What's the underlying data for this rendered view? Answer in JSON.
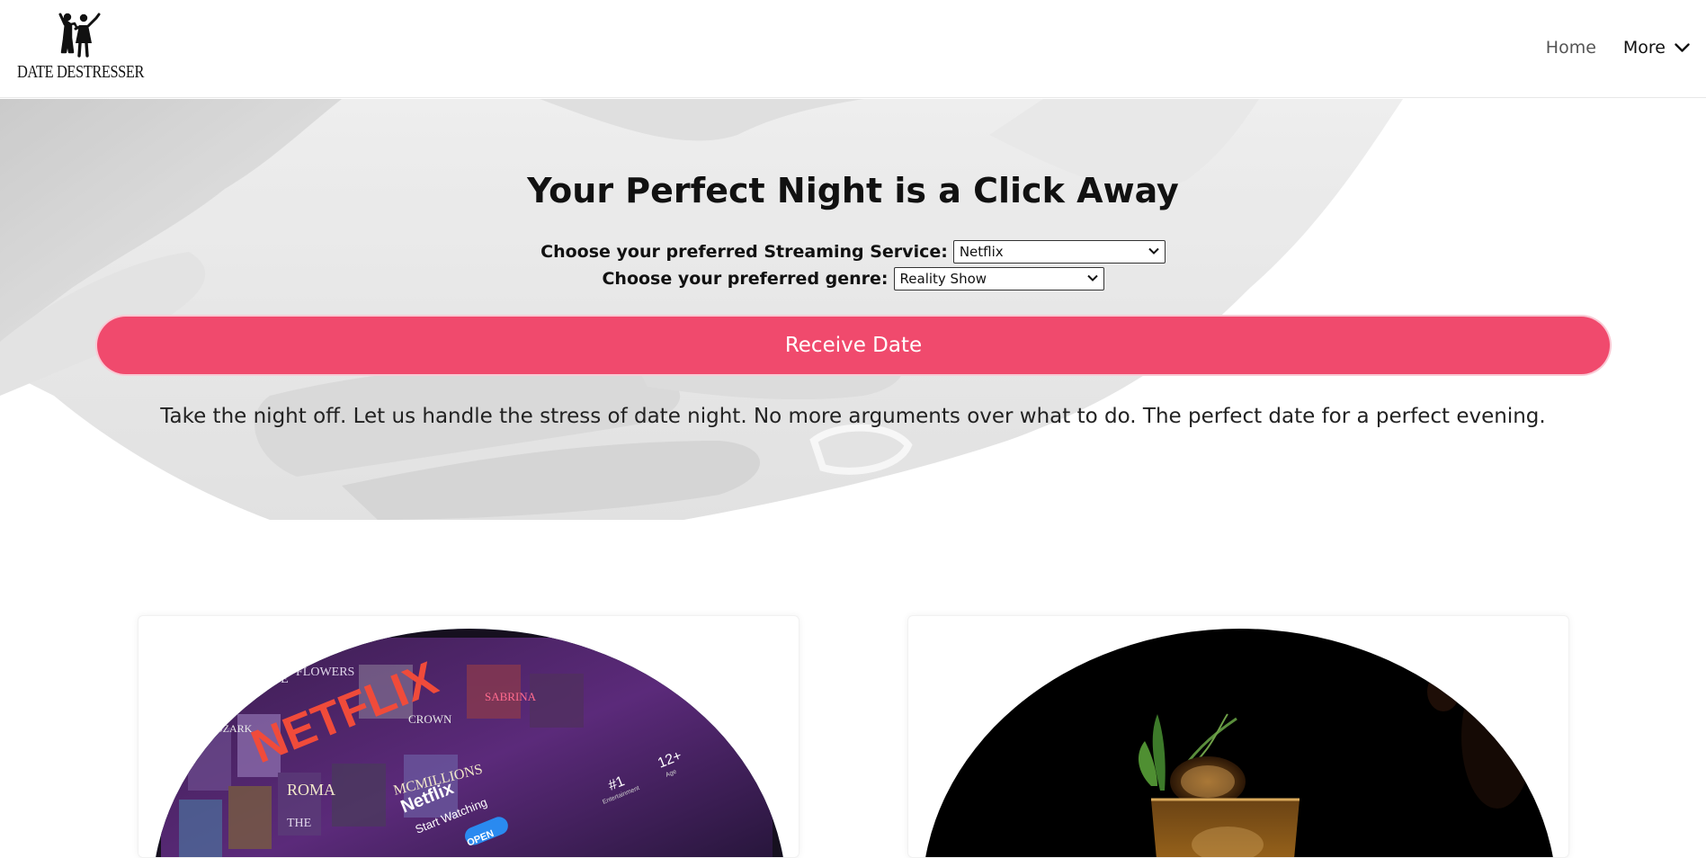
{
  "header": {
    "logo_text": "DATE DESTRESSER",
    "logo_icon": "dancing-couple-icon",
    "nav": {
      "home_label": "Home",
      "more_label": "More",
      "more_icon": "chevron-down-icon"
    }
  },
  "hero": {
    "title": "Your Perfect Night is a Click Away",
    "streaming_label": "Choose your preferred Streaming Service:",
    "streaming_value": "Netflix",
    "genre_label": "Choose your preferred genre:",
    "genre_value": "Reality Show",
    "cta_label": "Receive Date",
    "tagline": "Take the night off. Let us handle the stress of date night. No more arguments over what to do. The perfect date for a perfect evening."
  },
  "cards": [
    {
      "image": "netflix-tablet-photo",
      "image_text": {
        "brand": "NETFLIX",
        "app_name": "Netflix",
        "app_sub": "Start Watching",
        "open": "OPEN",
        "rank": "#1",
        "rank_sub": "Entertainment",
        "age": "12+",
        "age_sub": "Age",
        "tiles": [
          "HOUSE",
          "FLOWERS",
          "OZARK",
          "CROWN",
          "ROMA",
          "MCMILLIONS",
          "SABRINA",
          "THE"
        ]
      }
    },
    {
      "image": "cocktail-photo"
    }
  ],
  "colors": {
    "accent": "#f04a6d",
    "accent_glow": "#f9c9d4",
    "text": "#111111",
    "nav_muted": "#555555"
  }
}
